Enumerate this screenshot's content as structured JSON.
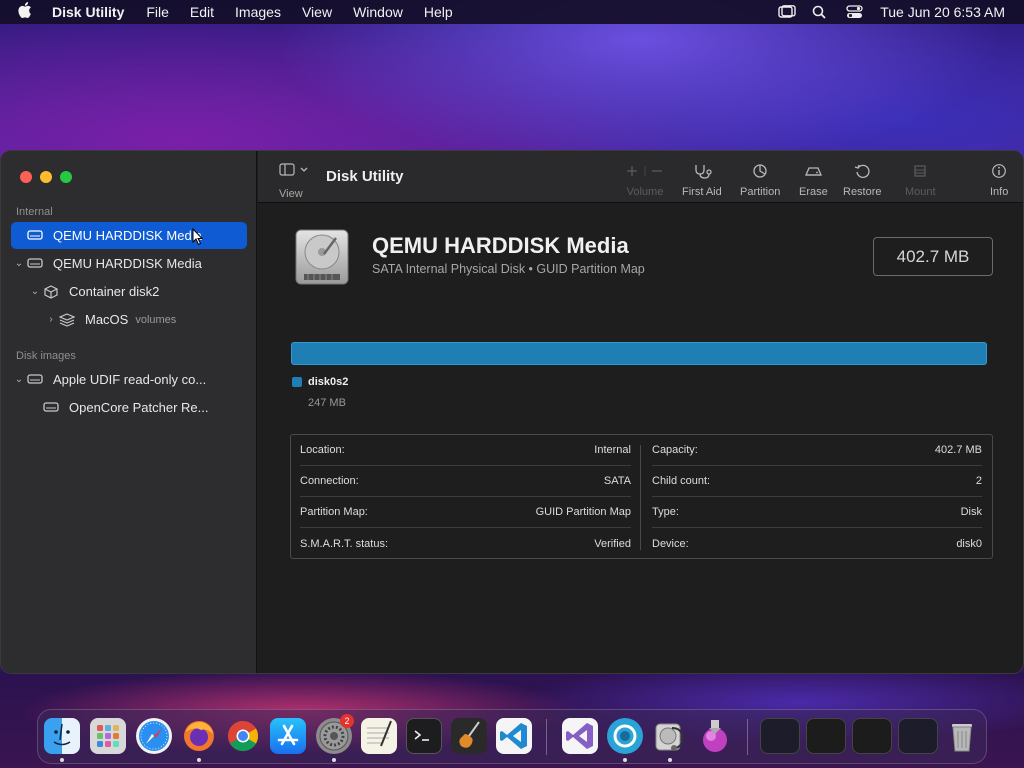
{
  "menubar": {
    "app_name": "Disk Utility",
    "items": [
      "File",
      "Edit",
      "Images",
      "View",
      "Window",
      "Help"
    ],
    "clock": "Tue Jun 20  6:53 AM"
  },
  "sidebar": {
    "section_internal": "Internal",
    "section_images": "Disk images",
    "items": [
      {
        "label": "QEMU HARDDISK Media",
        "selected": true
      },
      {
        "label": "QEMU HARDDISK Media"
      },
      {
        "label": "Container disk2"
      },
      {
        "label": "MacOS",
        "sub": "volumes"
      },
      {
        "label": "Apple UDIF read-only co..."
      },
      {
        "label": "OpenCore Patcher Re..."
      }
    ]
  },
  "toolbar": {
    "view_label": "View",
    "title": "Disk Utility",
    "buttons": {
      "volume": "Volume",
      "first_aid": "First Aid",
      "partition": "Partition",
      "erase": "Erase",
      "restore": "Restore",
      "mount": "Mount",
      "info": "Info"
    }
  },
  "disk": {
    "name": "QEMU HARDDISK Media",
    "subtitle": "SATA Internal Physical Disk • GUID Partition Map",
    "size": "402.7 MB",
    "partition": {
      "name": "disk0s2",
      "size": "247 MB",
      "color": "#1f7fb4"
    }
  },
  "info": {
    "left": [
      {
        "label": "Location:",
        "value": "Internal"
      },
      {
        "label": "Connection:",
        "value": "SATA"
      },
      {
        "label": "Partition Map:",
        "value": "GUID Partition Map"
      },
      {
        "label": "S.M.A.R.T. status:",
        "value": "Verified"
      }
    ],
    "right": [
      {
        "label": "Capacity:",
        "value": "402.7 MB"
      },
      {
        "label": "Child count:",
        "value": "2"
      },
      {
        "label": "Type:",
        "value": "Disk"
      },
      {
        "label": "Device:",
        "value": "disk0"
      }
    ]
  },
  "dock": {
    "badge_system_settings": "2",
    "apps": [
      "Finder",
      "Launchpad",
      "Safari",
      "Firefox",
      "Chrome",
      "App Store",
      "System Settings",
      "TextEdit",
      "Terminal",
      "GarageBand",
      "VS Code",
      "Visual Studio",
      "OpenCore",
      "Disk Utility",
      "Installer",
      "Trash"
    ]
  },
  "colors": {
    "accent": "#0f5bd3",
    "partition": "#1f7fb4"
  }
}
